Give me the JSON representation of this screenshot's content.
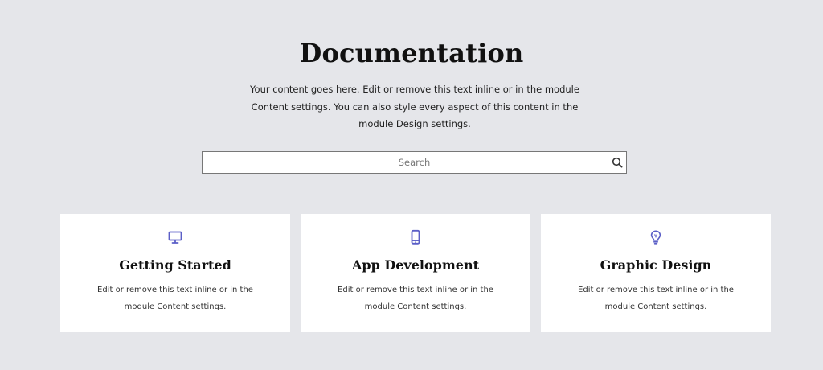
{
  "header": {
    "title": "Documentation",
    "intro": "Your content goes here. Edit or remove this text inline or in the module Content settings. You can also style every aspect of this content in the module Design settings."
  },
  "search": {
    "placeholder": "Search",
    "value": "",
    "icon": "search-icon"
  },
  "accent_color": "#5b5fc7",
  "cards": [
    {
      "icon": "desktop-icon",
      "title": "Getting Started",
      "text": "Edit or remove this text inline or in the module Content settings."
    },
    {
      "icon": "mobile-icon",
      "title": "App Development",
      "text": "Edit or remove this text inline or in the module Content settings."
    },
    {
      "icon": "lightbulb-icon",
      "title": "Graphic Design",
      "text": "Edit or remove this text inline or in the module Content settings."
    }
  ]
}
